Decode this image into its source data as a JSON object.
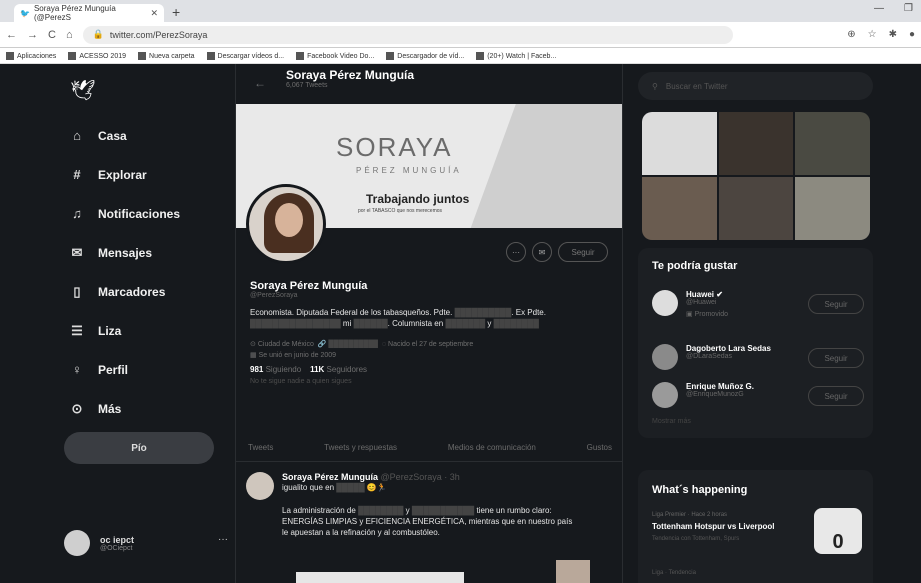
{
  "browser": {
    "tab_title": "Soraya Pérez Munguía (@PerezS",
    "url": "twitter.com/PerezSoraya",
    "bookmarks": [
      "Aplicaciones",
      "ACESSO 2019",
      "Nueva carpeta",
      "Descargar vídeos d...",
      "Facebook Video Do...",
      "Descargador de víd...",
      "(20+) Watch | Faceb..."
    ]
  },
  "nav": {
    "items": [
      {
        "label": "Casa",
        "icon": "home-icon"
      },
      {
        "label": "Explorar",
        "icon": "hashtag-icon"
      },
      {
        "label": "Notificaciones",
        "icon": "bell-icon"
      },
      {
        "label": "Mensajes",
        "icon": "envelope-icon"
      },
      {
        "label": "Marcadores",
        "icon": "bookmark-icon"
      },
      {
        "label": "Liza",
        "icon": "list-icon"
      },
      {
        "label": "Perfil",
        "icon": "person-icon"
      },
      {
        "label": "Más",
        "icon": "more-circle-icon"
      }
    ],
    "tweet_button": "Pío",
    "account_name": "oc iepct",
    "account_handle": "@OCiepct"
  },
  "profile": {
    "header_name": "Soraya Pérez Munguía",
    "header_tweets": "6,067 Tweets",
    "banner_title": "SORAYA",
    "banner_subtitle": "PÉREZ MUNGUÍA",
    "banner_tagline": "Trabajando juntos",
    "banner_small": "por el TABASCO que nos merecemos",
    "name": "Soraya Pérez Munguía",
    "handle": "@PerezSoraya",
    "follow_label": "Seguir",
    "bio_1": "Economista. Diputada Federal de los tabasqueños. Pdte.",
    "bio_2": "Ex Pdte.",
    "bio_3": "mi",
    "bio_4": ". Columnista en",
    "bio_5": "y",
    "location": "Ciudad de México",
    "birthday": "Nacido el 27 de septiembre",
    "joined": "Se unió en junio de 2009",
    "following_count": "981",
    "following_label": "Siguiendo",
    "followers_count": "11K",
    "followers_label": "Seguidores",
    "not_followed": "No te sigue nadie a quien sigues"
  },
  "tabs": [
    "Tweets",
    "Tweets y respuestas",
    "Medios de comunicación",
    "Gustos"
  ],
  "tweet": {
    "name": "Soraya Pérez Munguía",
    "handle": "@PerezSoraya · 3h",
    "line1": "igualito que en",
    "line2": "La administración de",
    "line2b": "y",
    "line2c": "tiene un rumbo claro:",
    "line3": "ENERGÍAS LIMPIAS y EFICIENCIA ENERGÉTICA, mientras que en nuestro país",
    "line4": "le apuestan a la refinación y al combustóleo."
  },
  "right": {
    "search_placeholder": "Buscar en Twitter",
    "wtf_title": "Te podría gustar",
    "suggestions": [
      {
        "name": "Huawei",
        "handle": "@Huawei",
        "promo": "Promovido",
        "btn": "Seguir"
      },
      {
        "name": "Dagoberto Lara Sedas",
        "handle": "@DLaraSedas",
        "btn": "Seguir"
      },
      {
        "name": "Enrique Muñoz G.",
        "handle": "@EnriqueMunozG",
        "btn": "Seguir"
      }
    ],
    "show_more": "Mostrar más",
    "happening_title": "What´s happening",
    "trend_category": "Liga Premier · Hace 2 horas",
    "trend_title": "Tottenham Hotspur vs Liverpool",
    "trend_sub": "Tendencia con Tottenham, Spurs",
    "trend_score": "0",
    "next_cat": "Liga · Tendencia"
  }
}
